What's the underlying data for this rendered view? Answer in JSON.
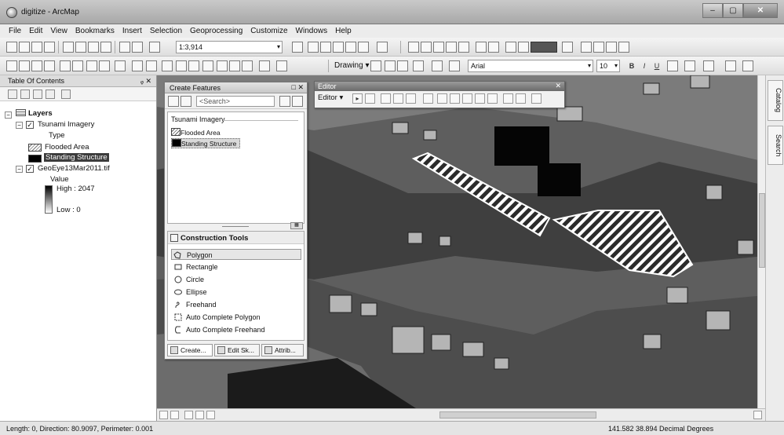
{
  "window": {
    "title": "digitize - ArcMap",
    "controls": [
      "–",
      "▢",
      "✕"
    ]
  },
  "menu": [
    "File",
    "Edit",
    "View",
    "Bookmarks",
    "Insert",
    "Selection",
    "Geoprocessing",
    "Customize",
    "Windows",
    "Help"
  ],
  "toolbar": {
    "scale": "1:3,914",
    "drawing_label": "Drawing ▾",
    "font": "Arial",
    "font_size": "10",
    "bold": "B",
    "italic": "I",
    "underline": "U"
  },
  "toc": {
    "title": "Table Of Contents",
    "controls": "ᵩ ✕",
    "layers_label": "Layers",
    "layer1": "Tsunami Imagery",
    "type_label": "Type",
    "cat1": "Flooded Area",
    "cat2": "Standing Structure",
    "layer2": "GeoEye13Mar2011.tif",
    "value_label": "Value",
    "high": "High : 2047",
    "low": "Low : 0"
  },
  "create_features": {
    "title": "Create Features",
    "controls": "□ ✕",
    "search_placeholder": "<Search>",
    "group": "Tsunami Imagery",
    "items": [
      "Flooded Area",
      "Standing Structure"
    ],
    "construction_title": "Construction Tools",
    "tools": [
      "Polygon",
      "Rectangle",
      "Circle",
      "Ellipse",
      "Freehand",
      "Auto Complete Polygon",
      "Auto Complete Freehand"
    ],
    "tabs": [
      "Create...",
      "Edit Sk...",
      "Attrib..."
    ]
  },
  "editor": {
    "title": "Editor",
    "close": "✕",
    "menu_label": "Editor ▾"
  },
  "dock": {
    "catalog": "Catalog",
    "search": "Search"
  },
  "status": {
    "left": "Length: 0, Direction: 80.9097, Perimeter: 0.001",
    "right": "141.582  38.894 Decimal Degrees"
  },
  "colors": {
    "selection": "#3c3c3c",
    "hatch": "#777777",
    "title_bar": "#b0b0b0"
  }
}
